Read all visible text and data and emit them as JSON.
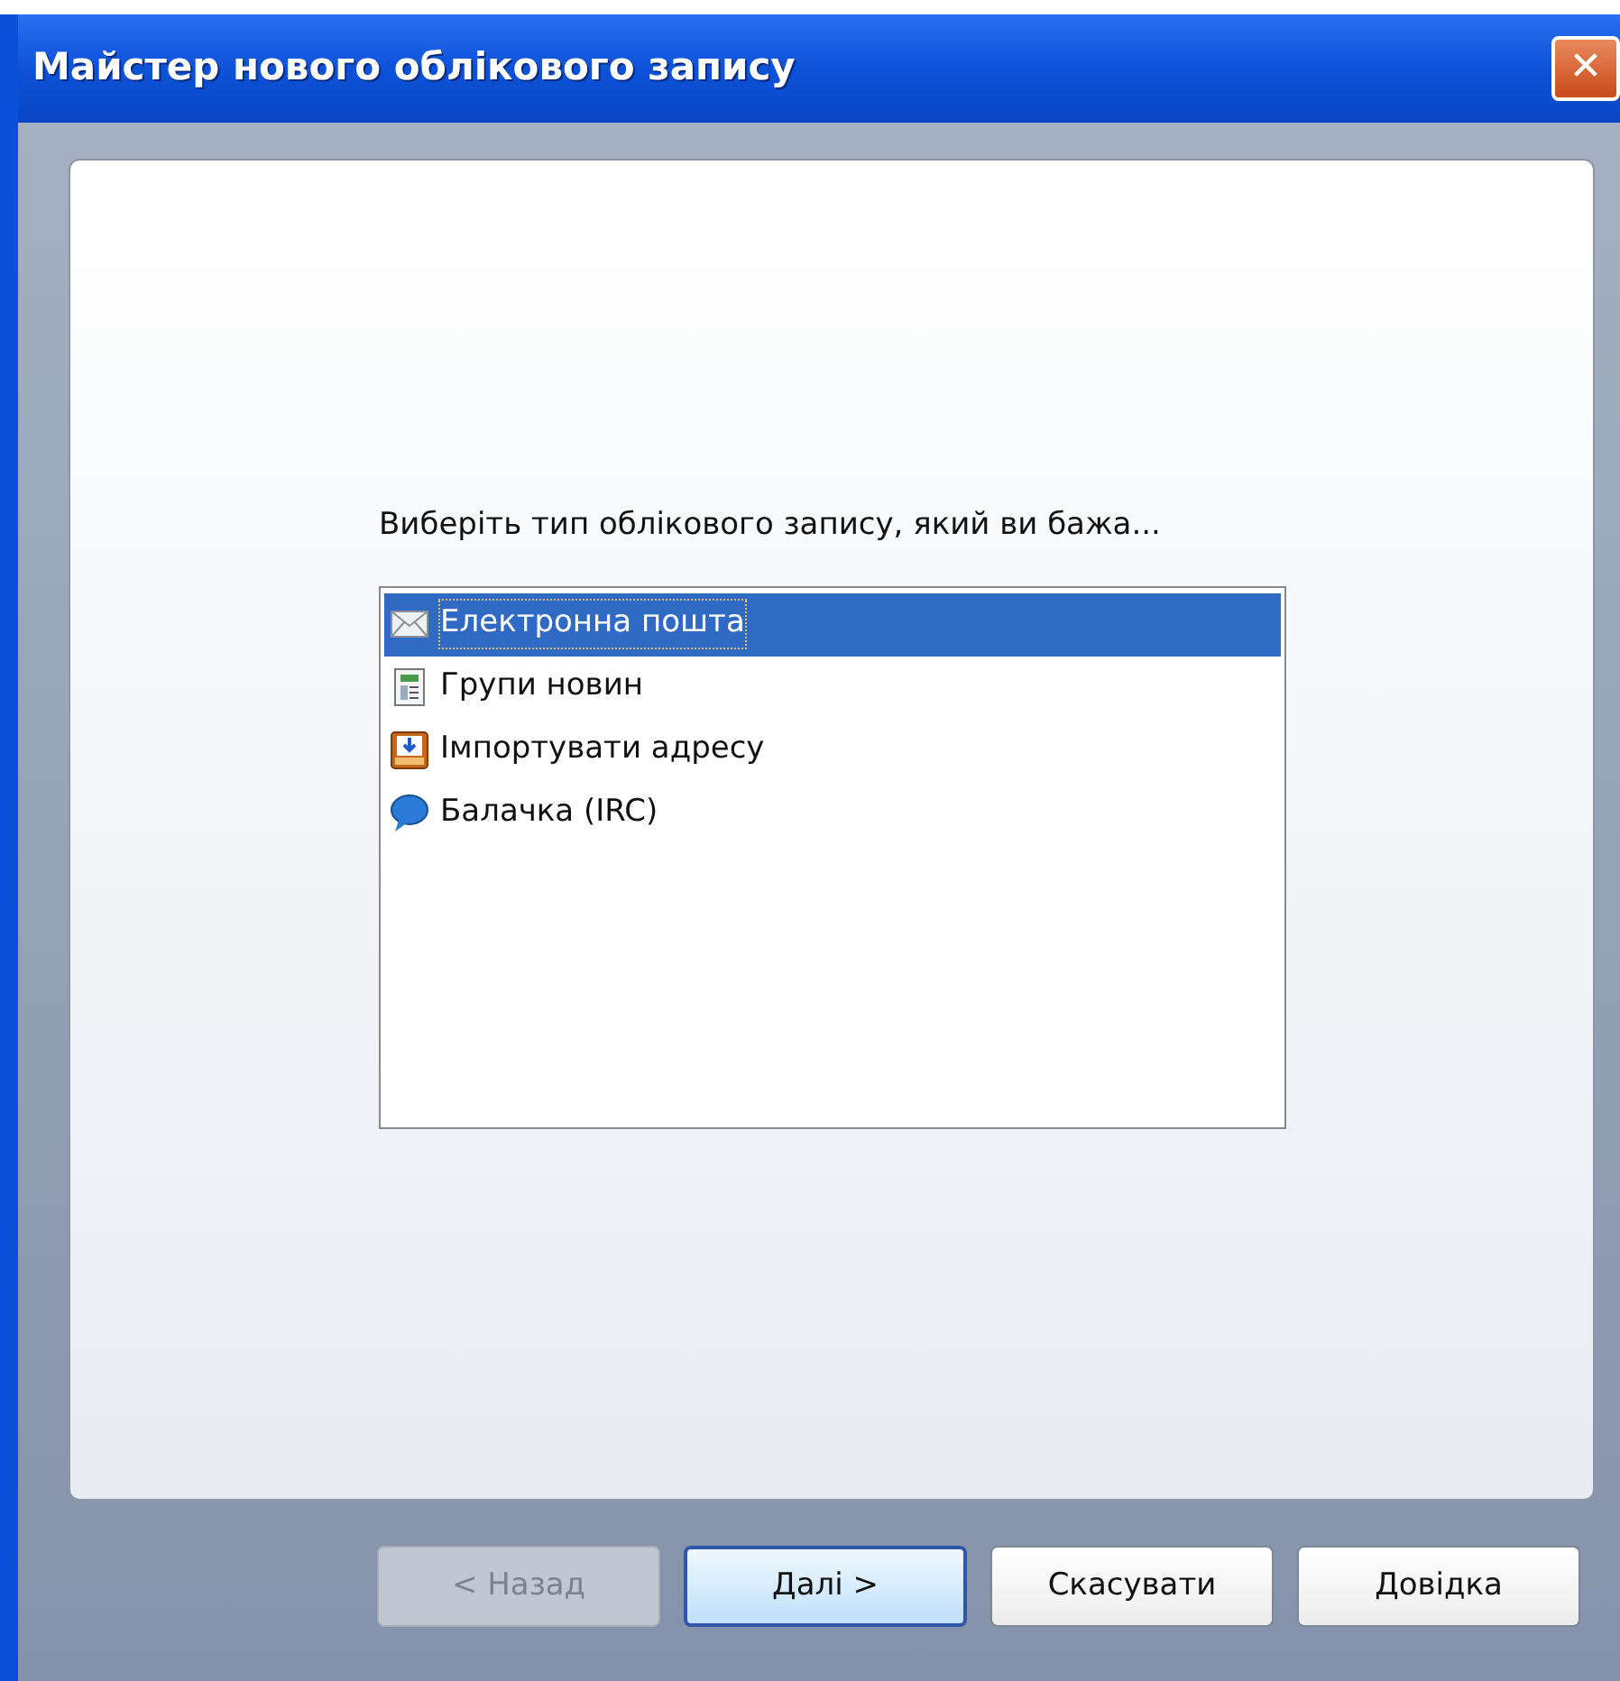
{
  "window": {
    "title": "Майстер нового облікового запису",
    "close": "✕"
  },
  "prompt": "Виберіть тип облікового запису, який ви бажа...",
  "account_types": [
    {
      "label": "Електронна пошта",
      "kind": "mail",
      "selected": true
    },
    {
      "label": "Групи новин",
      "kind": "news",
      "selected": false
    },
    {
      "label": "Імпортувати адресу",
      "kind": "import",
      "selected": false
    },
    {
      "label": "Балачка (IRC)",
      "kind": "chat",
      "selected": false
    }
  ],
  "buttons": [
    {
      "label": "< Назад",
      "disabled": true,
      "default": false
    },
    {
      "label": "Далі >",
      "disabled": false,
      "default": true
    },
    {
      "label": "Скасувати",
      "disabled": false,
      "default": false
    },
    {
      "label": "Довідка",
      "disabled": false,
      "default": false
    }
  ]
}
